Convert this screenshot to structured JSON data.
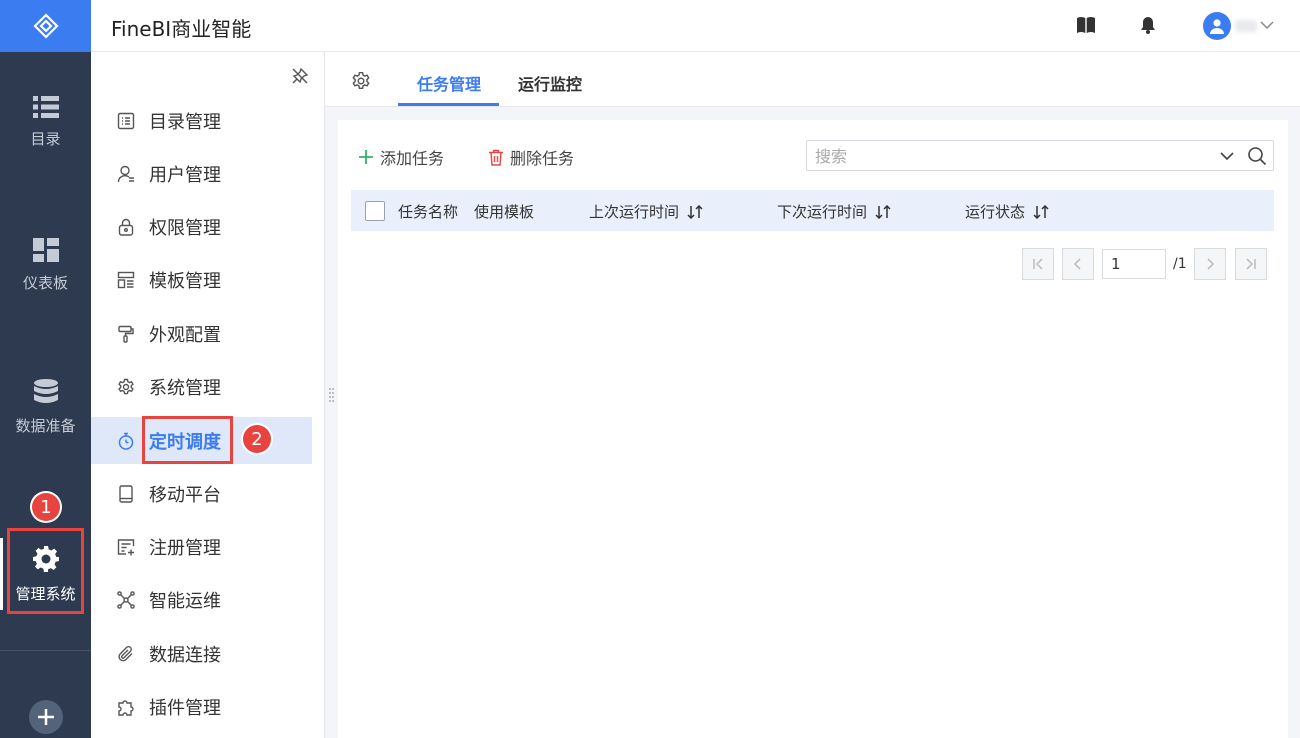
{
  "app": {
    "title": "FineBI商业智能"
  },
  "rail": {
    "items": [
      {
        "label": "目录",
        "icon": "list-icon"
      },
      {
        "label": "仪表板",
        "icon": "dashboard-icon"
      },
      {
        "label": "数据准备",
        "icon": "database-icon"
      },
      {
        "label": "管理系统",
        "icon": "gear-icon",
        "active": true
      }
    ]
  },
  "submenu": {
    "items": [
      {
        "label": "目录管理",
        "icon": "catalog-icon"
      },
      {
        "label": "用户管理",
        "icon": "user-icon"
      },
      {
        "label": "权限管理",
        "icon": "lock-icon"
      },
      {
        "label": "模板管理",
        "icon": "template-icon"
      },
      {
        "label": "外观配置",
        "icon": "paint-roller-icon"
      },
      {
        "label": "系统管理",
        "icon": "gear-icon"
      },
      {
        "label": "定时调度",
        "icon": "stopwatch-icon",
        "active": true
      },
      {
        "label": "移动平台",
        "icon": "tablet-icon"
      },
      {
        "label": "注册管理",
        "icon": "register-icon"
      },
      {
        "label": "智能运维",
        "icon": "network-icon"
      },
      {
        "label": "数据连接",
        "icon": "paperclip-icon"
      },
      {
        "label": "插件管理",
        "icon": "puzzle-icon"
      }
    ]
  },
  "tabs": {
    "task": "任务管理",
    "monitor": "运行监控"
  },
  "toolbar": {
    "add": "添加任务",
    "delete": "删除任务"
  },
  "search": {
    "placeholder": "搜索"
  },
  "table": {
    "columns": [
      "任务名称",
      "使用模板",
      "上次运行时间",
      "下次运行时间",
      "运行状态"
    ]
  },
  "pagination": {
    "current": "1",
    "total": "/1"
  },
  "annotations": {
    "step1": "1",
    "step2": "2"
  },
  "colors": {
    "accent": "#3b7cf0",
    "rail": "#2d3a4f",
    "annotation": "#e8443f"
  }
}
